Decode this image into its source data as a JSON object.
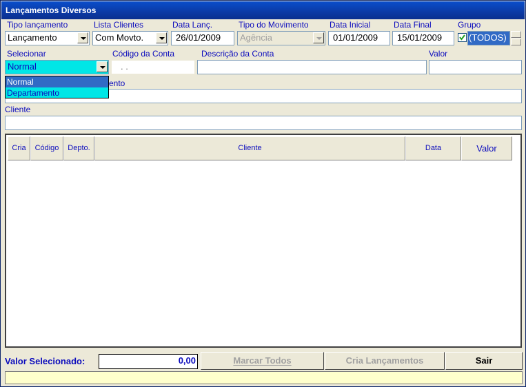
{
  "window": {
    "title": "Lançamentos Diversos"
  },
  "filters": {
    "tipo_lancamento": {
      "label": "Tipo lançamento",
      "value": "Lançamento"
    },
    "lista_clientes": {
      "label": "Lista Clientes",
      "value": "Com Movto."
    },
    "data_lanc": {
      "label": "Data Lanç.",
      "value": "26/01/2009"
    },
    "tipo_movimento": {
      "label": "Tipo do Movimento",
      "value": "Agência"
    },
    "data_inicial": {
      "label": "Data Inicial",
      "value": "01/01/2009"
    },
    "data_final": {
      "label": "Data Final",
      "value": "15/01/2009"
    },
    "grupo": {
      "label": "Grupo",
      "value": "(TODOS)",
      "checked": true
    }
  },
  "account": {
    "selecionar_label": "Selecionar",
    "selecionar_value": "Normal",
    "codigo_label": "Código da Conta",
    "codigo_value": ". .",
    "descricao_label": "Descrição da Conta",
    "descricao_value": "",
    "valor_label": "Valor",
    "valor_value": ""
  },
  "dropdown_options": [
    "Normal",
    "Departamento"
  ],
  "complemento_label_visible": "ento",
  "complemento_value": "",
  "cliente": {
    "label": "Cliente",
    "value": ""
  },
  "table": {
    "columns": [
      "Cria",
      "Código",
      "Depto.",
      "Cliente",
      "Data",
      "Valor"
    ],
    "rows": []
  },
  "footer": {
    "valor_selecionado_label": "Valor Selecionado:",
    "valor_selecionado_value": "0,00",
    "marcar_todos": "Marcar Todos",
    "cria_lancamentos": "Cria Lançamentos",
    "sair": "Sair"
  },
  "status_text": "",
  "colors": {
    "label_blue": "#0c0cbd",
    "dropdown_highlight": "#00e6e6",
    "dropdown_selected": "#316ac5",
    "status_bg": "#ffffcc"
  }
}
